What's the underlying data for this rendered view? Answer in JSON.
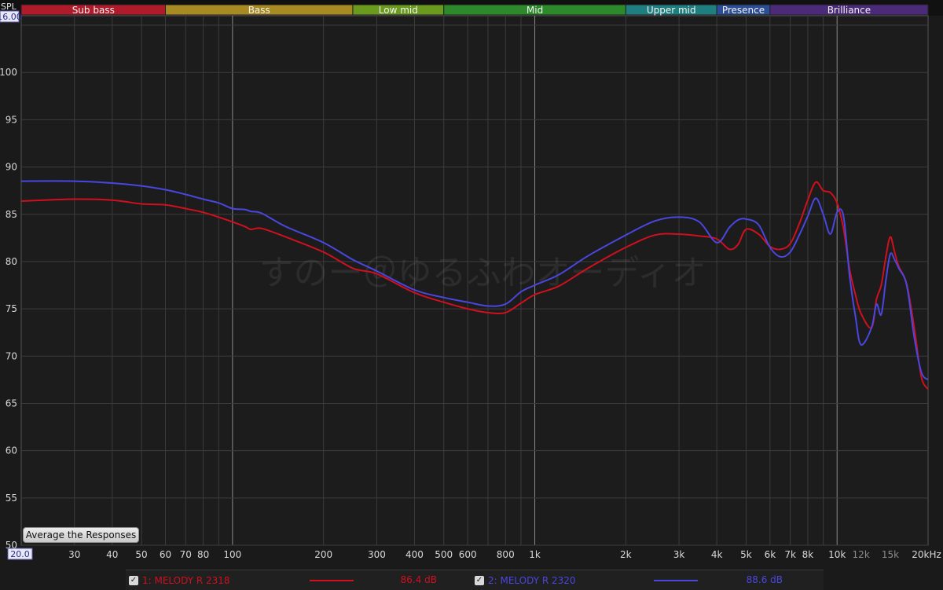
{
  "chart_data": {
    "type": "line",
    "ylabel": "SPL",
    "x_scale": "log",
    "xlim": [
      20,
      20000
    ],
    "ylim": [
      50,
      106
    ],
    "y_ticks": [
      "100",
      "95",
      "90",
      "85",
      "80",
      "75",
      "70",
      "65",
      "60",
      "55",
      "50"
    ],
    "y_range_readout": "16.00",
    "x_range_readout": "20.0",
    "x_ticks": [
      {
        "v": 30,
        "label": "30"
      },
      {
        "v": 40,
        "label": "40"
      },
      {
        "v": 50,
        "label": "50"
      },
      {
        "v": 60,
        "label": "60"
      },
      {
        "v": 70,
        "label": "70"
      },
      {
        "v": 80,
        "label": "80"
      },
      {
        "v": 100,
        "label": "100"
      },
      {
        "v": 200,
        "label": "200"
      },
      {
        "v": 300,
        "label": "300"
      },
      {
        "v": 400,
        "label": "400"
      },
      {
        "v": 500,
        "label": "500"
      },
      {
        "v": 600,
        "label": "600"
      },
      {
        "v": 800,
        "label": "800"
      },
      {
        "v": 1000,
        "label": "1k"
      },
      {
        "v": 2000,
        "label": "2k"
      },
      {
        "v": 3000,
        "label": "3k"
      },
      {
        "v": 4000,
        "label": "4k"
      },
      {
        "v": 5000,
        "label": "5k"
      },
      {
        "v": 6000,
        "label": "6k"
      },
      {
        "v": 7000,
        "label": "7k"
      },
      {
        "v": 8000,
        "label": "8k"
      },
      {
        "v": 10000,
        "label": "10k"
      },
      {
        "v": 12000,
        "label": "12k"
      },
      {
        "v": 15000,
        "label": "15k"
      },
      {
        "v": 20000,
        "label": "20kHz"
      }
    ],
    "bands": [
      {
        "label": "Sub bass",
        "from": 20,
        "to": 60,
        "color": "#b01b2b"
      },
      {
        "label": "Bass",
        "from": 60,
        "to": 250,
        "color": "#a88a22"
      },
      {
        "label": "Low mid",
        "from": 250,
        "to": 500,
        "color": "#6a9a1e"
      },
      {
        "label": "Mid",
        "from": 500,
        "to": 2000,
        "color": "#2c8a2a"
      },
      {
        "label": "Upper mid",
        "from": 2000,
        "to": 4000,
        "color": "#1f7f80"
      },
      {
        "label": "Presence",
        "from": 4000,
        "to": 6000,
        "color": "#2b4e96"
      },
      {
        "label": "Brilliance",
        "from": 6000,
        "to": 20000,
        "color": "#4c2a7a"
      }
    ],
    "watermark": "すのー＠ゆるふわオーディオ",
    "series": [
      {
        "name": "1: MELODY R 2318",
        "level": "86.4 dB",
        "color": "#d0101e",
        "x": [
          20,
          30,
          40,
          50,
          60,
          70,
          80,
          90,
          100,
          110,
          115,
          125,
          150,
          200,
          250,
          300,
          400,
          500,
          600,
          700,
          800,
          900,
          1000,
          1200,
          1500,
          2000,
          2500,
          3000,
          3500,
          4000,
          4400,
          4700,
          5000,
          5500,
          6000,
          6500,
          7000,
          7500,
          8000,
          8500,
          9000,
          9500,
          10000,
          10500,
          11000,
          11500,
          12000,
          13000,
          13500,
          14000,
          14500,
          15000,
          15500,
          16000,
          17000,
          18000,
          19000,
          20000
        ],
        "y": [
          86.4,
          86.6,
          86.5,
          86.1,
          86.0,
          85.6,
          85.2,
          84.7,
          84.2,
          83.7,
          83.4,
          83.5,
          82.6,
          81.0,
          79.3,
          78.7,
          76.7,
          75.7,
          75.0,
          74.6,
          74.6,
          75.6,
          76.5,
          77.4,
          79.3,
          81.5,
          82.8,
          82.9,
          82.7,
          82.4,
          81.3,
          81.8,
          83.4,
          82.9,
          81.6,
          81.3,
          81.9,
          84.0,
          86.5,
          88.4,
          87.5,
          87.3,
          86.2,
          83.5,
          79.2,
          76.5,
          74.5,
          73.0,
          76.0,
          77.5,
          80.5,
          82.6,
          81.0,
          79.5,
          77.6,
          73.0,
          67.8,
          66.5
        ]
      },
      {
        "name": "2: MELODY R 2320",
        "level": "88.6 dB",
        "color": "#4a46e0",
        "x": [
          20,
          30,
          40,
          50,
          60,
          70,
          80,
          90,
          100,
          110,
          115,
          125,
          150,
          200,
          250,
          300,
          400,
          500,
          600,
          700,
          800,
          900,
          1000,
          1200,
          1500,
          2000,
          2500,
          3000,
          3500,
          4000,
          4400,
          4700,
          5000,
          5500,
          6000,
          6500,
          7000,
          7500,
          8000,
          8500,
          9000,
          9500,
          10000,
          10500,
          11000,
          11500,
          12000,
          13000,
          13500,
          14000,
          14500,
          15000,
          15500,
          16000,
          17000,
          18000,
          19000,
          20000
        ],
        "y": [
          88.5,
          88.5,
          88.3,
          88.0,
          87.6,
          87.1,
          86.6,
          86.2,
          85.6,
          85.5,
          85.3,
          85.1,
          83.7,
          82.0,
          80.2,
          79.0,
          77.0,
          76.2,
          75.7,
          75.3,
          75.5,
          76.8,
          77.5,
          78.6,
          80.6,
          82.8,
          84.3,
          84.7,
          84.2,
          82.0,
          83.6,
          84.4,
          84.5,
          83.9,
          81.5,
          80.5,
          81.0,
          82.8,
          84.8,
          86.7,
          85.0,
          82.9,
          85.2,
          84.8,
          78.5,
          74.2,
          71.2,
          73.0,
          75.5,
          74.4,
          78.0,
          80.8,
          80.2,
          79.3,
          77.5,
          72.0,
          68.3,
          67.5
        ]
      }
    ]
  },
  "ui": {
    "avg_button": "Average the Responses",
    "check_mark": "✓"
  }
}
